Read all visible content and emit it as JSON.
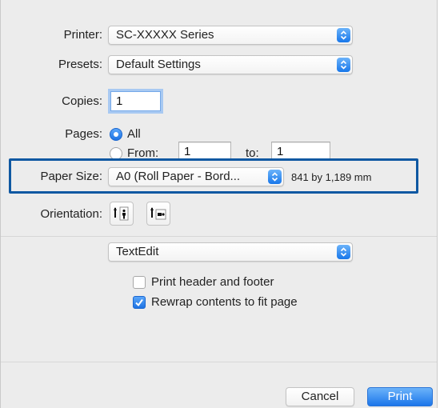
{
  "printer": {
    "label": "Printer:",
    "value": "SC-XXXXX Series"
  },
  "presets": {
    "label": "Presets:",
    "value": "Default Settings"
  },
  "copies": {
    "label": "Copies:",
    "value": "1"
  },
  "pages": {
    "label": "Pages:",
    "all_label": "All",
    "from_label": "From:",
    "from_value": "1",
    "to_label": "to:",
    "to_value": "1",
    "selected": "All"
  },
  "paper_size": {
    "label": "Paper Size:",
    "value": "A0 (Roll Paper - Bord...",
    "dimensions": "841 by 1,189 mm"
  },
  "orientation": {
    "label": "Orientation:",
    "options": [
      "portrait-icon",
      "landscape-icon"
    ],
    "selected": "portrait"
  },
  "section_popup": {
    "value": "TextEdit"
  },
  "options": {
    "print_header_footer": {
      "label": "Print header and footer",
      "checked": false
    },
    "rewrap_contents": {
      "label": "Rewrap contents to fit page",
      "checked": true
    }
  },
  "buttons": {
    "cancel": "Cancel",
    "print": "Print"
  },
  "colors": {
    "accent": "#1e73e3",
    "highlight_border": "#0f58a2",
    "dialog_bg": "#ececec"
  }
}
